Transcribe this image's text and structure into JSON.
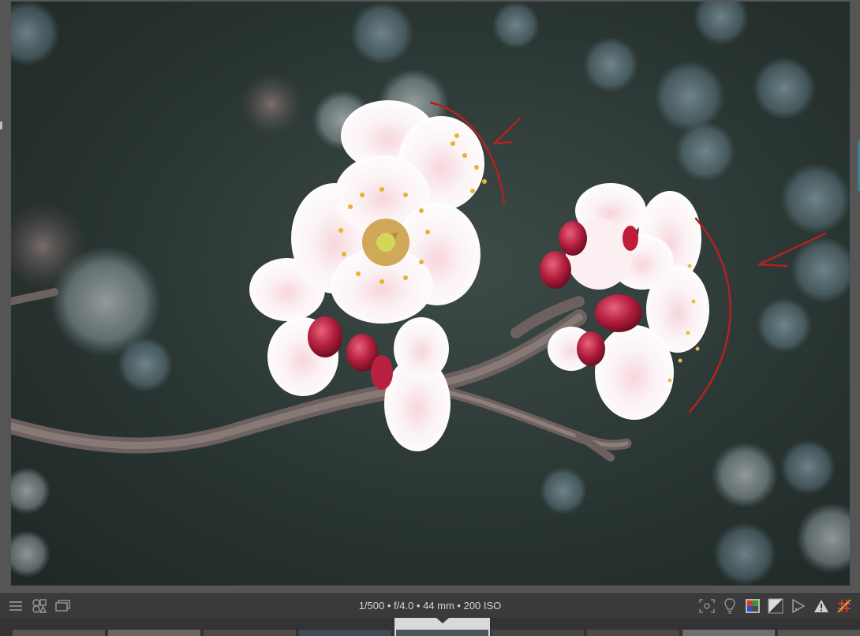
{
  "viewer": {
    "image_description_name": "plum-blossom-photo",
    "annotation_color": "#b22222"
  },
  "toolbar": {
    "left_icons": [
      "menu-icon",
      "shapes-icon",
      "monitor-icon"
    ],
    "exif": "1/500 • f/4.0 • 44 mm • 200 ISO",
    "right_icons": [
      "focus-mask-icon",
      "lightbulb-icon",
      "color-assessment-icon",
      "exposure-compare-icon",
      "softproof-icon",
      "gamut-warning-icon",
      "grid-overlay-icon"
    ]
  },
  "filmstrip": {
    "thumbnail_count": 9,
    "selected_index": 4
  }
}
